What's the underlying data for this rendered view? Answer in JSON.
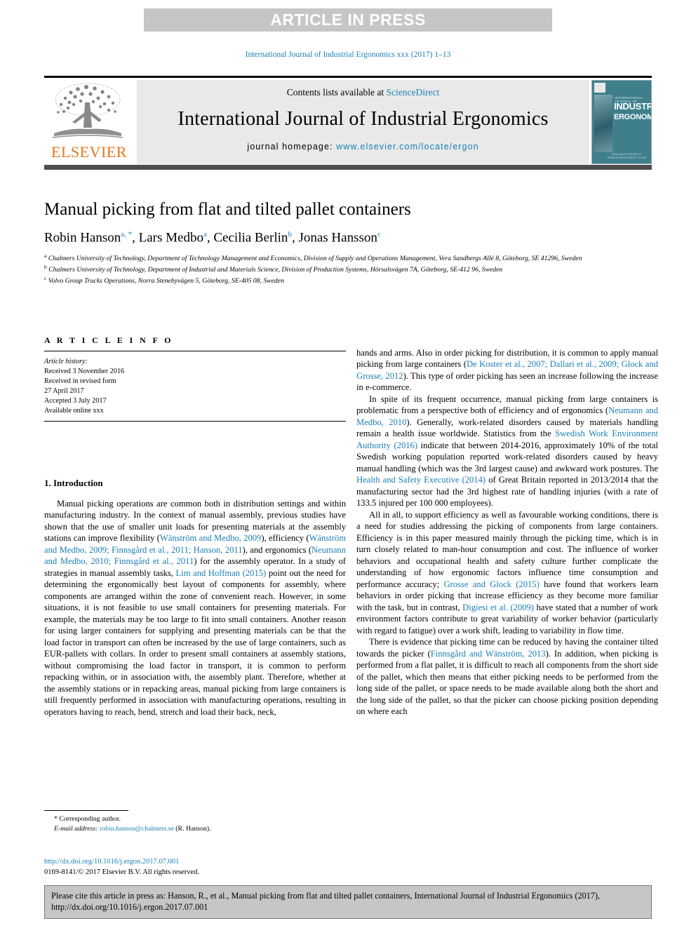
{
  "banner": {
    "text": "ARTICLE IN PRESS"
  },
  "running_head": "International Journal of Industrial Ergonomics xxx (2017) 1–13",
  "masthead": {
    "contents_prefix": "Contents lists available at ",
    "contents_link": "ScienceDirect",
    "journal_title": "International Journal of Industrial Ergonomics",
    "homepage_label": "journal homepage: ",
    "homepage_url": "www.elsevier.com/locate/ergon",
    "publisher": "ELSEVIER",
    "cover": {
      "subtitle": "INTERNATIONAL JOURNAL OF",
      "line1": "INDUSTRIAL",
      "line2": "ERGONOMICS",
      "footer": "AVAILABLE ONLINE AT WWW.SCIENCEDIRECT.COM"
    }
  },
  "article": {
    "title": "Manual picking from flat and tilted pallet containers",
    "authors": [
      {
        "name": "Robin Hanson",
        "marks": "a, *"
      },
      {
        "name": "Lars Medbo",
        "marks": "a"
      },
      {
        "name": "Cecilia Berlin",
        "marks": "b"
      },
      {
        "name": "Jonas Hansson",
        "marks": "c"
      }
    ],
    "affiliations": [
      {
        "mark": "a",
        "text": "Chalmers University of Technology, Department of Technology Management and Economics, Division of Supply and Operations Management, Vera Sandbergs Allé 8, Göteborg, SE 41296, Sweden"
      },
      {
        "mark": "b",
        "text": "Chalmers University of Technology, Department of Industrial and Materials Science, Division of Production Systems, Hörsalsvägen 7A, Göteborg, SE-412 96, Sweden"
      },
      {
        "mark": "c",
        "text": "Volvo Group Trucks Operations, Norra Stenebyvägen 5, Göteborg, SE-405 08, Sweden"
      }
    ]
  },
  "article_info": {
    "heading": "A R T I C L E  I N F O",
    "history_label": "Article history:",
    "history": [
      "Received 3 November 2016",
      "Received in revised form",
      "27 April 2017",
      "Accepted 3 July 2017",
      "Available online xxx"
    ]
  },
  "introduction": {
    "heading": "1.  Introduction",
    "paragraph_1_a": "Manual picking operations are common both in distribution settings and within manufacturing industry. In the context of manual assembly, previous studies have shown that the use of smaller unit loads for presenting materials at the assembly stations can improve flexibility (",
    "cite_1": "Wänström and Medbo, 2009",
    "paragraph_1_b": "), efficiency (",
    "cite_2": "Wänström and Medbo, 2009; Finnsgård et al., 2011; Hanson, 2011",
    "paragraph_1_c": "), and ergonomics (",
    "cite_3": "Neumann and Medbo, 2010; Finnsgård et al., 2011",
    "paragraph_1_d": ") for the assembly operator. In a study of strategies in manual assembly tasks, ",
    "cite_4": "Lim and Hoffman (2015)",
    "paragraph_1_e": " point out the need for determining the ergonomically best layout of components for assembly, where components are arranged within the zone of convenient reach. However, in some situations, it is not feasible to use small containers for presenting materials. For example, the materials may be too large to fit into small containers. Another reason for using larger containers for supplying and presenting materials can be that the load factor in transport can often be increased by the use of large containers, such as EUR-pallets with collars. In order to present small containers at assembly stations, without compromising the load factor in transport, it is common to perform repacking within, or in association with, the assembly plant. Therefore, whether at the assembly stations or in repacking areas, manual picking from large containers is still frequently performed in association with manufacturing operations, resulting in operators having to reach, bend, stretch and load their back, neck,"
  },
  "right_column": {
    "p1_a": "hands and arms. Also in order picking for distribution, it is common to apply manual picking from large containers (",
    "p1_cite": "De Koster et al., 2007; Dallari et al., 2009; Glock and Grosse, 2012",
    "p1_b": "). This type of order picking has seen an increase following the increase in e-commerce.",
    "p2_a": "In spite of its frequent occurrence, manual picking from large containers is problematic from a perspective both of efficiency and of ergonomics (",
    "p2_cite1": "Neumann and Medbo, 2010",
    "p2_b": "). Generally, work-related disorders caused by materials handling remain a health issue worldwide. Statistics from the ",
    "p2_cite2": "Swedish Work Environment Authority (2016)",
    "p2_c": " indicate that between 2014-2016, approximately 10% of the total Swedish working population reported work-related disorders caused by heavy manual handling (which was the 3rd largest cause) and awkward work postures. The ",
    "p2_cite3": "Health and Safety Executive (2014)",
    "p2_d": " of Great Britain reported in 2013/2014 that the manufacturing sector had the 3rd highest rate of handling injuries (with a rate of 133.5 injured per 100 000 employees).",
    "p3_a": "All in all, to support efficiency as well as favourable working conditions, there is a need for studies addressing the picking of components from large containers. Efficiency is in this paper measured mainly through the picking time, which is in turn closely related to man-hour consumption and cost. The influence of worker behaviors and occupational health and safety culture further complicate the understanding of how ergonomic factors influence time consumption and performance accuracy; ",
    "p3_cite1": "Grosse and Glock (2015)",
    "p3_b": " have found that workers learn behaviors in order picking that increase efficiency as they become more familiar with the task, but in contrast, ",
    "p3_cite2": "Digiesi et al. (2009)",
    "p3_c": " have stated that a number of work environment factors contribute to great variability of worker behavior (particularly with regard to fatigue) over a work shift, leading to variability in flow time.",
    "p4_a": "There is evidence that picking time can be reduced by having the container tilted towards the picker (",
    "p4_cite1": "Finnsgård and Wänström, 2013",
    "p4_b": "). In addition, when picking is performed from a flat pallet, it is difficult to reach all components from the short side of the pallet, which then means that either picking needs to be performed from the long side of the pallet, or space needs to be made available along both the short and the long side of the pallet, so that the picker can choose picking position depending on where each"
  },
  "footnote": {
    "corresponding": "* Corresponding author.",
    "email_label": "E-mail address: ",
    "email": "robin.hanson@chalmers.se",
    "email_suffix": " (R. Hanson).",
    "doi": "http://dx.doi.org/10.1016/j.ergon.2017.07.001",
    "copyright": "0169-8141/© 2017 Elsevier B.V. All rights reserved."
  },
  "citation_box": {
    "text": "Please cite this article in press as: Hanson, R., et al., Manual picking from flat and tilted pallet containers, International Journal of Industrial Ergonomics (2017), http://dx.doi.org/10.1016/j.ergon.2017.07.001"
  },
  "colors": {
    "link": "#1a7fb5",
    "banner_bg": "#c6c6c6",
    "elsevier_orange": "#e8761b",
    "masthead_band": "#e9e9e9"
  }
}
